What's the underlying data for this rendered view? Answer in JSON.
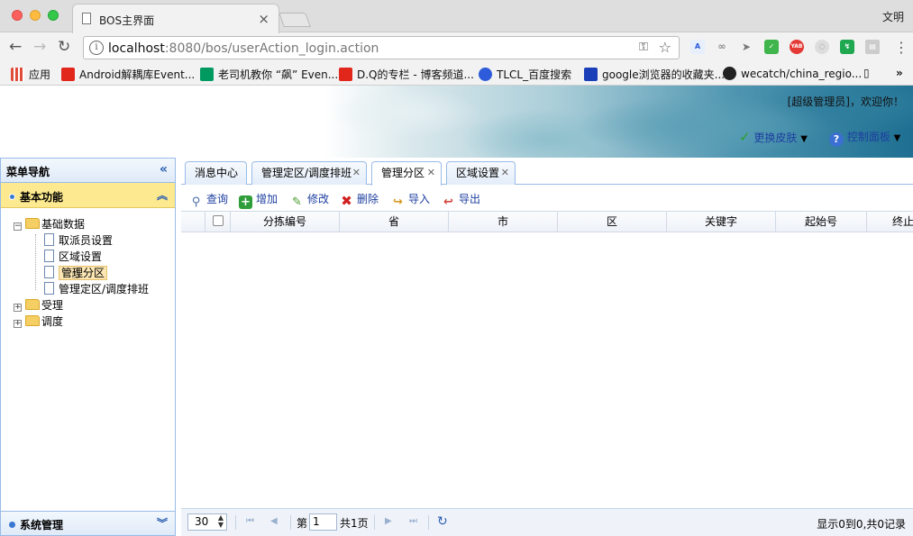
{
  "browser": {
    "tab_title": "BOS主界面",
    "user": "文明",
    "url_host": "localhost",
    "url_path": ":8080/bos/userAction_login.action",
    "bookmarks": [
      {
        "label": "应用",
        "color": "#e04b3a"
      },
      {
        "label": "Android解耦库Event...",
        "color": "#e1261c"
      },
      {
        "label": "老司机教你 “飙” Even...",
        "color": "#009a61"
      },
      {
        "label": "D.Q的专栏 - 博客频道...",
        "color": "#e1261c"
      },
      {
        "label": "TLCL_百度搜索",
        "color": "#2d5bd9"
      },
      {
        "label": "google浏览器的收藏夹...",
        "color": "#1a3fb8"
      },
      {
        "label": "wecatch/china_regio...",
        "color": "#222222"
      }
    ]
  },
  "header": {
    "welcome": "[超级管理员]，欢迎你！",
    "skin_label": "更换皮肤",
    "panel_label": "控制面板"
  },
  "west": {
    "title": "菜单导航",
    "section1": "基本功能",
    "tree": {
      "root1": "基础数据",
      "children": [
        "取派员设置",
        "区域设置",
        "管理分区",
        "管理定区/调度排班"
      ],
      "root2": "受理",
      "root3": "调度"
    },
    "section2": "系统管理"
  },
  "tabs": [
    {
      "label": "消息中心",
      "closable": false
    },
    {
      "label": "管理定区/调度排班",
      "closable": true
    },
    {
      "label": "管理分区",
      "closable": true,
      "active": true
    },
    {
      "label": "区域设置",
      "closable": true
    }
  ],
  "toolbar": {
    "query": "查询",
    "add": "增加",
    "edit": "修改",
    "delete": "删除",
    "import": "导入",
    "export": "导出"
  },
  "grid": {
    "columns": [
      "分拣编号",
      "省",
      "市",
      "区",
      "关键字",
      "起始号",
      "终止"
    ]
  },
  "pager": {
    "page_size": "30",
    "page_label": "第",
    "page_value": "1",
    "total_pages": "共1页",
    "info": "显示0到0,共0记录"
  }
}
